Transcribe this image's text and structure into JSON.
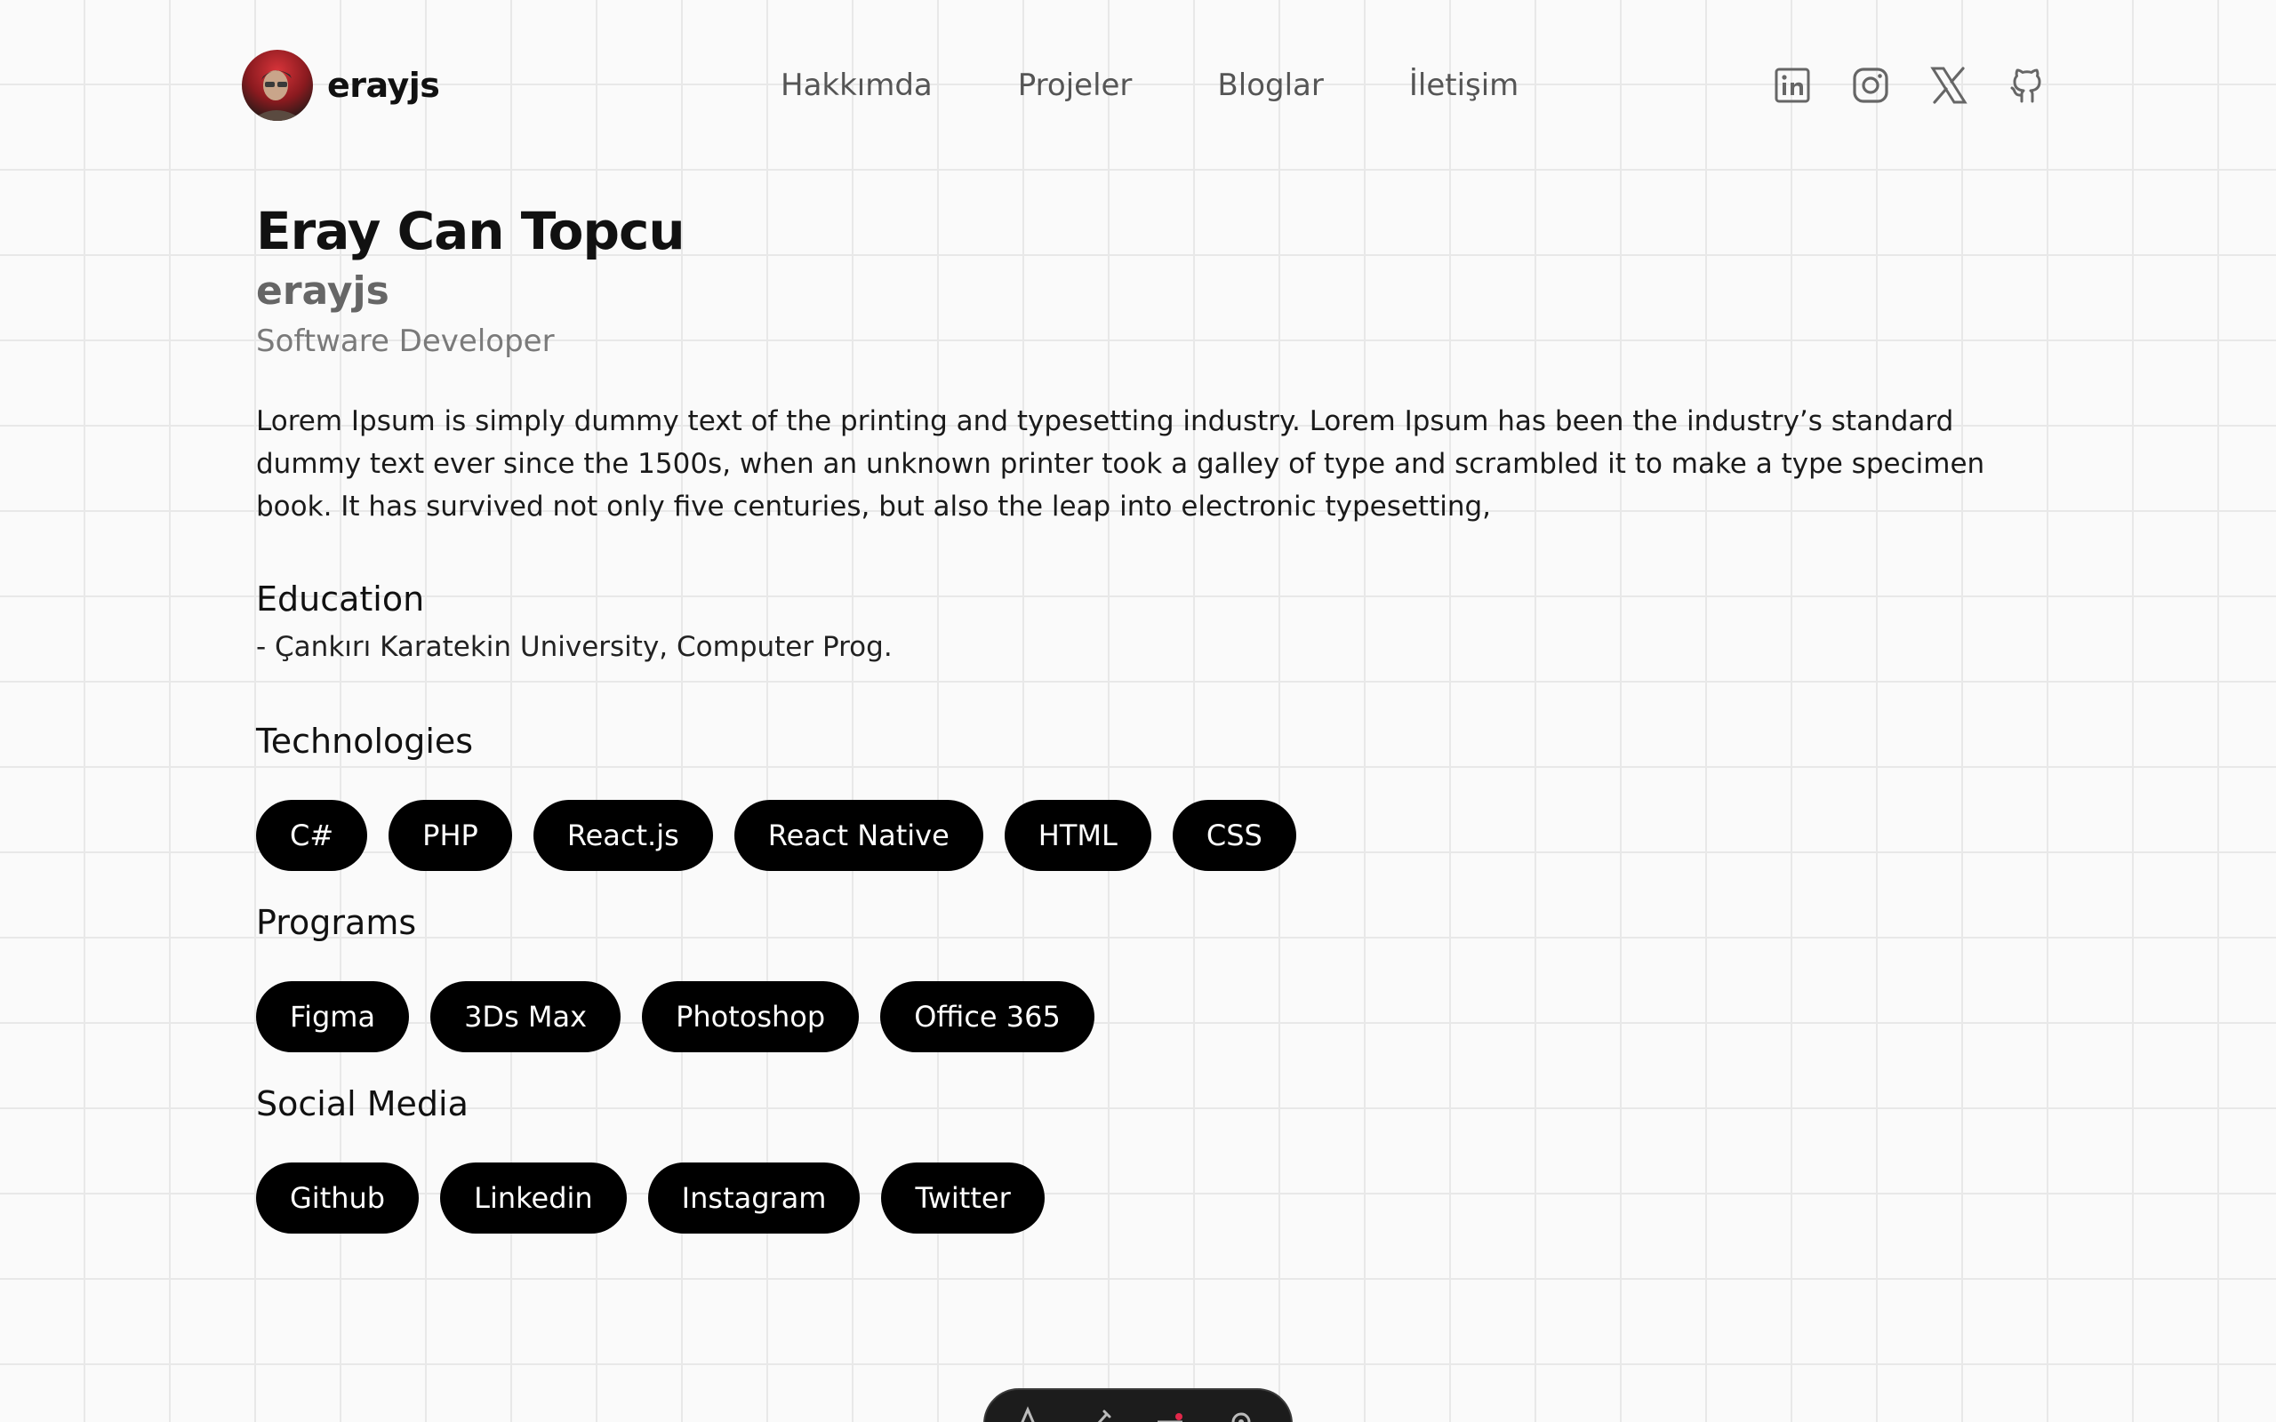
{
  "header": {
    "brand_name": "erayjs",
    "nav": [
      "Hakkımda",
      "Projeler",
      "Bloglar",
      "İletişim"
    ],
    "socials": [
      "linkedin-icon",
      "instagram-icon",
      "x-icon",
      "github-icon"
    ]
  },
  "profile": {
    "full_name": "Eray Can Topcu",
    "handle": "erayjs",
    "role": "Software Developer",
    "bio": "Lorem Ipsum is simply dummy text of the printing and typesetting industry. Lorem Ipsum has been the industry’s standard dummy text ever since the 1500s, when an unknown printer took a galley of type and scrambled it to make a type specimen book. It has survived not only five centuries, but also the leap into electronic typesetting,"
  },
  "education": {
    "title": "Education",
    "items": [
      "- Çankırı Karatekin University, Computer Prog."
    ]
  },
  "technologies": {
    "title": "Technologies",
    "items": [
      "C#",
      "PHP",
      "React.js",
      "React Native",
      "HTML",
      "CSS"
    ]
  },
  "programs": {
    "title": "Programs",
    "items": [
      "Figma",
      "3Ds Max",
      "Photoshop",
      "Office 365"
    ]
  },
  "social_media": {
    "title": "Social Media",
    "items": [
      "Github",
      "Linkedin",
      "Instagram",
      "Twitter"
    ]
  },
  "toolbar": {
    "icons": [
      "text-icon",
      "brush-icon",
      "slider-icon",
      "settings-icon"
    ],
    "accent": "#e0284a"
  },
  "colors": {
    "background": "#fafafa",
    "grid": "#e8e8e8",
    "pill_bg": "#000000",
    "pill_text": "#ffffff",
    "muted": "#666666"
  }
}
